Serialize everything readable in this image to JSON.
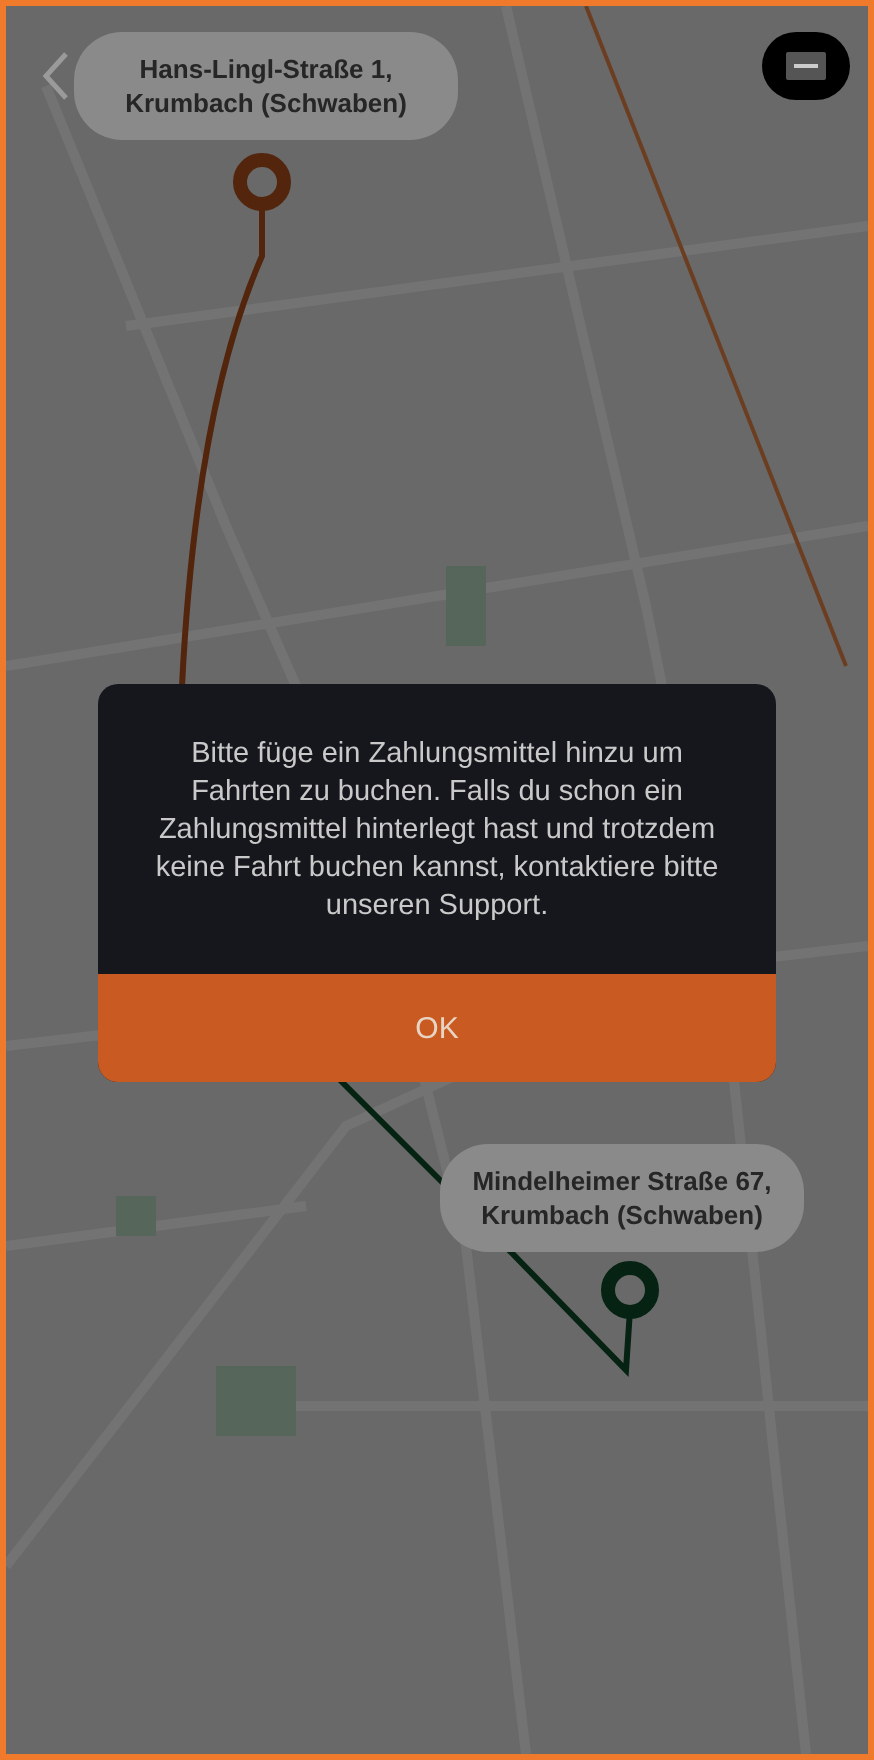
{
  "pickup": {
    "address": "Hans-Lingl-Straße 1, Krumbach (Schwaben)"
  },
  "dropoff": {
    "address": "Mindelheimer Straße 67, Krumbach (Schwaben)"
  },
  "dialog": {
    "message": "Bitte füge ein Zahlungsmittel hinzu um Fahrten zu buchen. Falls du schon ein Zahlungsmittel hinterlegt hast und trotzdem keine Fahrt buchen kannst, kontaktiere bitte unseren Support.",
    "button": "OK"
  }
}
